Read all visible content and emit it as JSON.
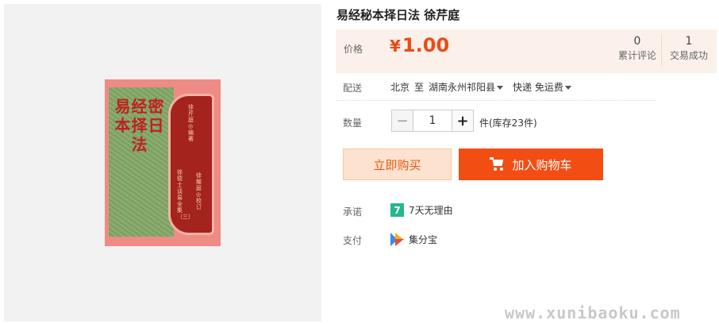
{
  "product": {
    "title": "易经秘本择日法 徐芹庭"
  },
  "cover": {
    "title": "易经密本择日法",
    "author_line": "徐芹庭◎编著",
    "series_line": "徐德士谈易全集（三）",
    "editor_line": "徐耀庭◎校订",
    "colors": {
      "background": "#ee8b84",
      "green": "#84a868",
      "panel": "#a4231d"
    }
  },
  "price": {
    "label": "价格",
    "symbol": "¥",
    "value": "1.00",
    "color": "#f04a14"
  },
  "stats": [
    {
      "num": "0",
      "label": "累计评论"
    },
    {
      "num": "1",
      "label": "交易成功"
    }
  ],
  "shipping": {
    "label": "配送",
    "from": "北京",
    "to_word": "至",
    "destination": "湖南永州祁阳县",
    "method": "快递 免运费"
  },
  "quantity": {
    "label": "数量",
    "value": "1",
    "minus": "−",
    "plus": "+",
    "stock_text": "件(库存23件)"
  },
  "actions": {
    "buy_now": "立即购买",
    "add_to_cart": "加入购物车",
    "accent": "#f24e14"
  },
  "promise": {
    "label": "承诺",
    "icon_text": "7",
    "text": "7天无理由"
  },
  "payment": {
    "label": "支付",
    "text": "集分宝"
  },
  "watermark": "www.xunibaoku.com"
}
